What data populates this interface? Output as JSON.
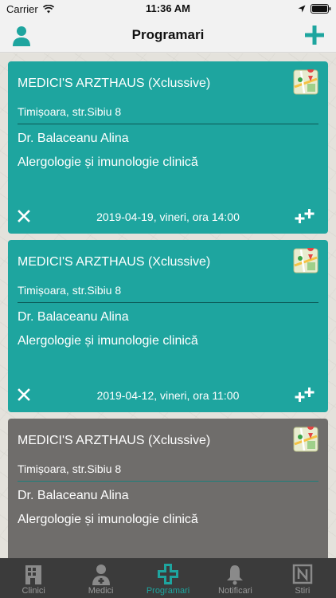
{
  "status_bar": {
    "carrier": "Carrier",
    "time": "11:36 AM"
  },
  "nav": {
    "title": "Programari",
    "left_icon": "user-icon",
    "right_icon": "plus-icon"
  },
  "colors": {
    "accent": "#1ea59f",
    "card_active": "#1ea59f",
    "card_past": "#6f6d6b",
    "tabbar": "#3b3b3b"
  },
  "appointments": [
    {
      "clinic": "MEDICI'S ARZTHAUS (Xclussive)",
      "address": "Timișoara, str.Sibiu 8",
      "doctor": "Dr. Balaceanu Alina",
      "specialty": "Alergologie și imunologie clinică",
      "datetime": "2019-04-19, vineri, ora 14:00",
      "status": "upcoming"
    },
    {
      "clinic": "MEDICI'S ARZTHAUS (Xclussive)",
      "address": "Timișoara, str.Sibiu 8",
      "doctor": "Dr. Balaceanu Alina",
      "specialty": "Alergologie și imunologie clinică",
      "datetime": "2019-04-12, vineri, ora 11:00",
      "status": "upcoming"
    },
    {
      "clinic": "MEDICI'S ARZTHAUS (Xclussive)",
      "address": "Timișoara, str.Sibiu 8",
      "doctor": "Dr. Balaceanu Alina",
      "specialty": "Alergologie și imunologie clinică",
      "datetime": "",
      "status": "past"
    }
  ],
  "tabs": [
    {
      "label": "Clinici",
      "icon": "building-icon",
      "active": false
    },
    {
      "label": "Medici",
      "icon": "doctor-icon",
      "active": false
    },
    {
      "label": "Programari",
      "icon": "medical-cross-icon",
      "active": true
    },
    {
      "label": "Notificari",
      "icon": "bell-icon",
      "active": false
    },
    {
      "label": "Stiri",
      "icon": "news-icon",
      "active": false
    }
  ]
}
